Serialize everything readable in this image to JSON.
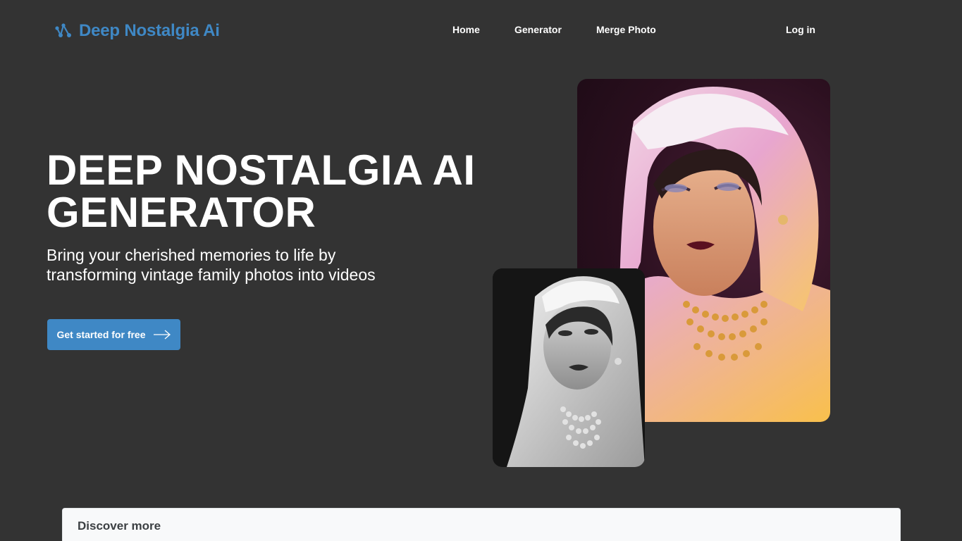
{
  "header": {
    "logo_text": "Deep Nostalgia Ai",
    "nav": [
      {
        "label": "Home"
      },
      {
        "label": "Generator"
      },
      {
        "label": "Merge Photo"
      }
    ],
    "login_label": "Log in"
  },
  "hero": {
    "title_line1": "DEEP NOSTALGIA AI",
    "title_line2": "GENERATOR",
    "subtitle_line1": "Bring your cherished memories to life by",
    "subtitle_line2": "transforming vintage family photos into videos",
    "cta_label": "Get started for free",
    "cta_icon": "arrow-right-icon"
  },
  "images": {
    "color_photo": "colorized-portrait-woman-headscarf",
    "bw_photo": "black-and-white-portrait-woman-headscarf"
  },
  "discover": {
    "label": "Discover more"
  },
  "colors": {
    "background": "#333333",
    "accent": "#3f88c5",
    "text": "#ffffff"
  }
}
